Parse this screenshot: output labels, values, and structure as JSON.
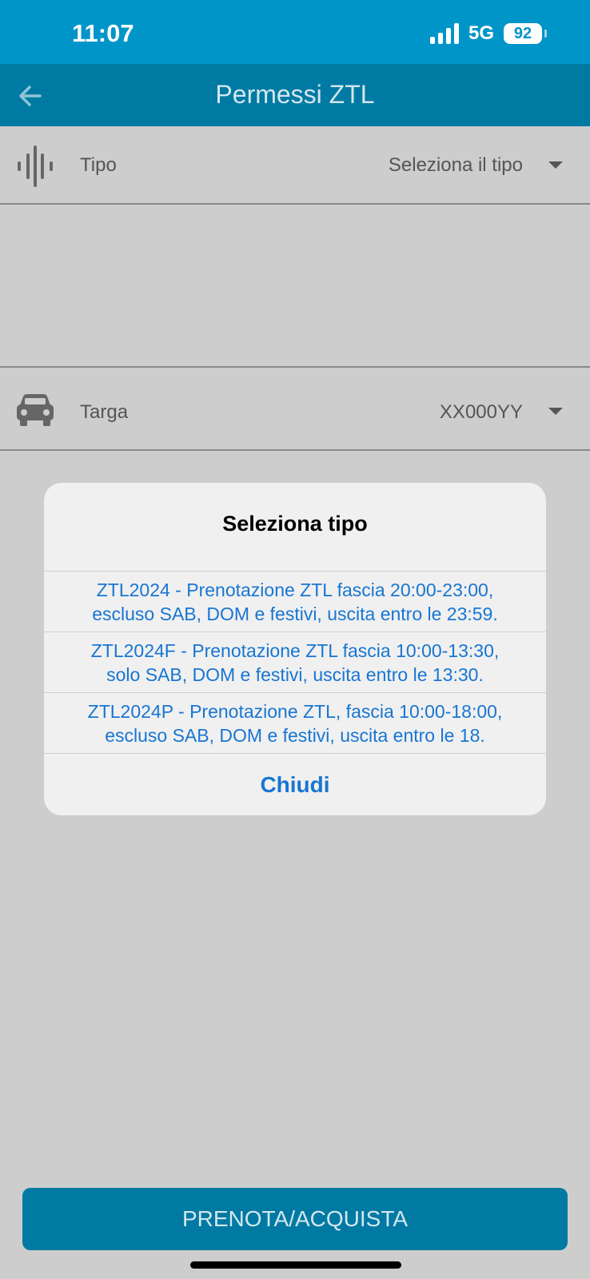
{
  "status": {
    "time": "11:07",
    "network": "5G",
    "battery": "92"
  },
  "header": {
    "title": "Permessi ZTL"
  },
  "form": {
    "tipo": {
      "label": "Tipo",
      "value": "Seleziona il tipo"
    },
    "targa": {
      "label": "Targa",
      "value": "XX000YY"
    }
  },
  "dialog": {
    "title": "Seleziona tipo",
    "options": [
      {
        "line1": "ZTL2024 - Prenotazione ZTL fascia 20:00-23:00,",
        "line2": "escluso SAB, DOM e festivi, uscita entro le 23:59."
      },
      {
        "line1": "ZTL2024F - Prenotazione ZTL fascia 10:00-13:30,",
        "line2": "solo SAB, DOM e festivi, uscita entro le 13:30."
      },
      {
        "line1": "ZTL2024P - Prenotazione ZTL, fascia 10:00-18:00,",
        "line2": "escluso SAB, DOM e festivi, uscita entro le 18."
      }
    ],
    "close_label": "Chiudi"
  },
  "action": {
    "label": "PRENOTA/ACQUISTA"
  },
  "colors": {
    "status_bar": "#0095c8",
    "header": "#007aa3",
    "link": "#1876d2",
    "overlay_bg": "#cdcdcd"
  },
  "icons": {
    "back": "arrow-left-icon",
    "tipo": "soundwave-icon",
    "targa": "car-icon",
    "dropdown": "caret-down-icon"
  }
}
